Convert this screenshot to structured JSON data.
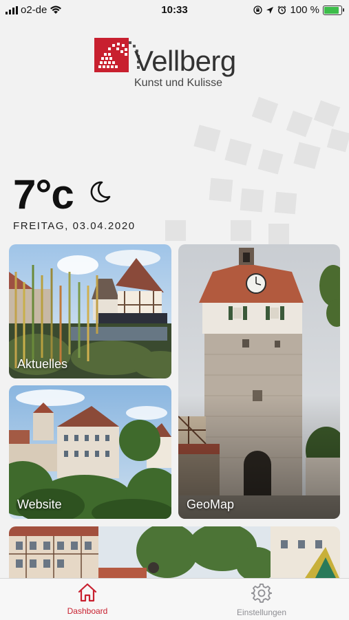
{
  "status_bar": {
    "carrier": "o2-de",
    "time": "10:33",
    "battery_percent": "100 %",
    "battery_level": 1.0
  },
  "brand": {
    "name": "Vellberg",
    "tagline": "Kunst und Kulisse",
    "accent_color": "#c8202f"
  },
  "weather": {
    "temperature": "7°c",
    "condition_icon": "moon-icon",
    "date": "FREITAG, 03.04.2020"
  },
  "tiles": {
    "aktuelles": "Aktuelles",
    "website": "Website",
    "geomap": "GeoMap"
  },
  "tab_bar": {
    "active_color": "#c8202f",
    "inactive_color": "#8e8e93",
    "items": [
      {
        "label": "Dashboard",
        "icon": "home-icon",
        "active": true
      },
      {
        "label": "Einstellungen",
        "icon": "gear-icon",
        "active": false
      }
    ]
  }
}
